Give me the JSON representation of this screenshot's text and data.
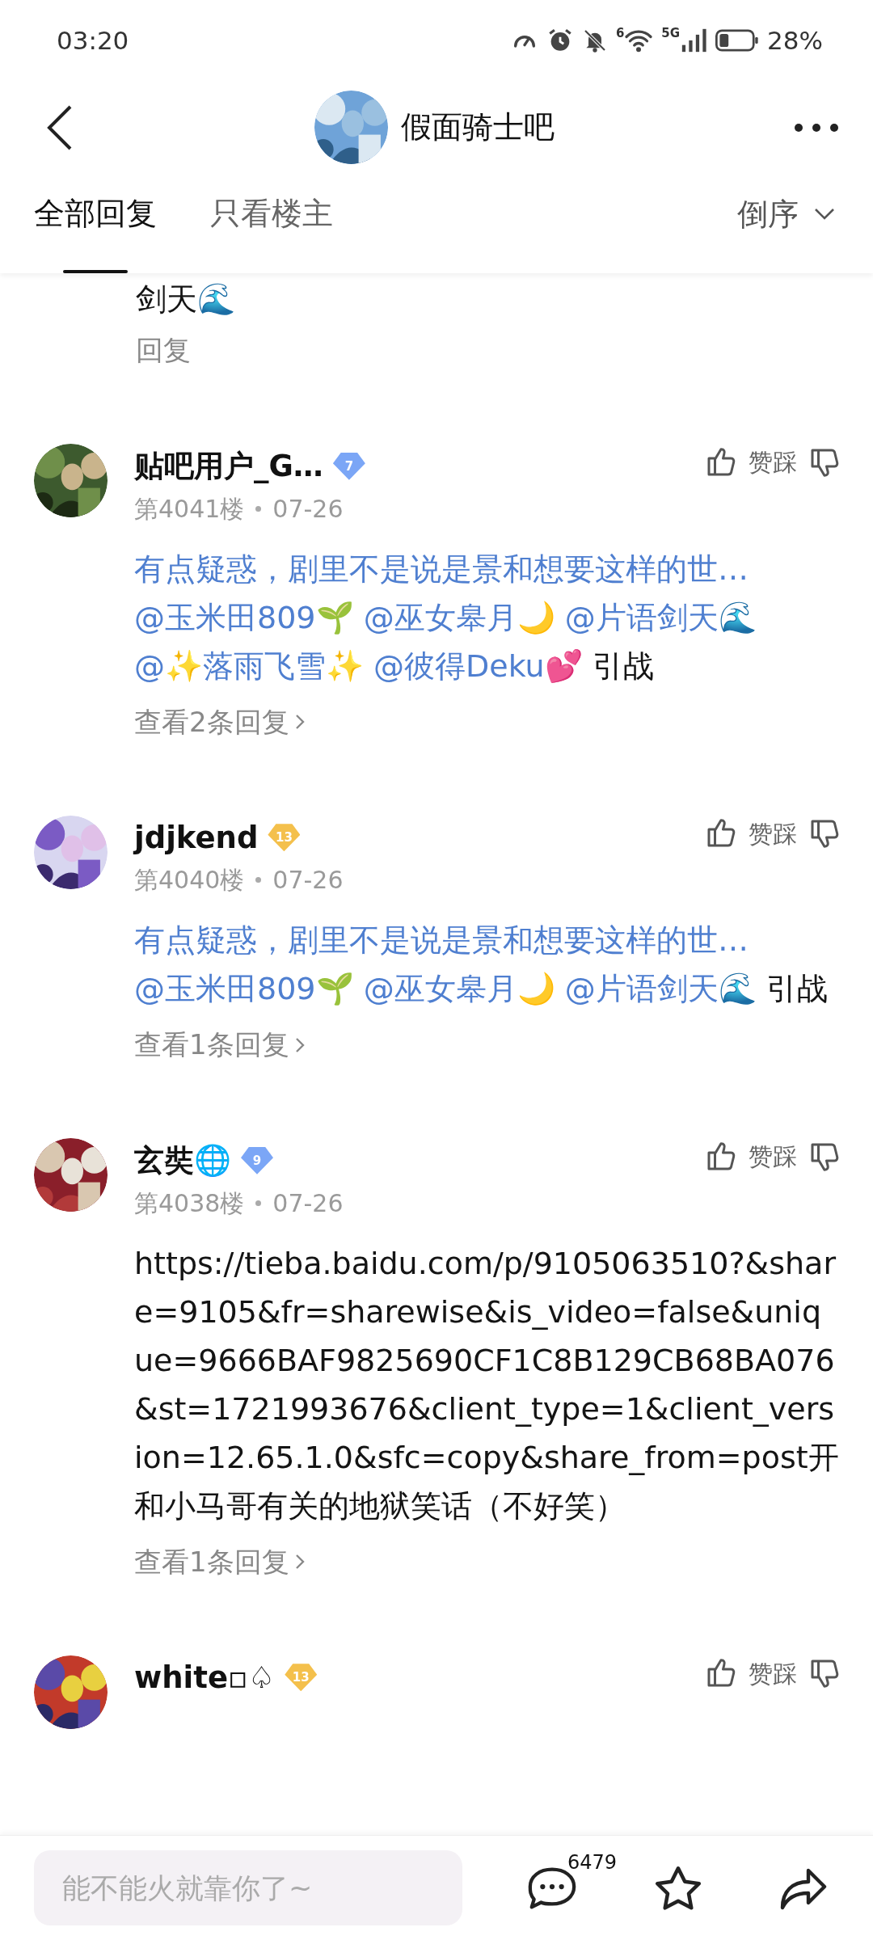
{
  "status_bar": {
    "time": "03:20",
    "wifi_label": "6",
    "network_label": "5G",
    "battery": "28%"
  },
  "header": {
    "title": "假面骑士吧"
  },
  "tabs": [
    {
      "label": "全部回复",
      "selected": true
    },
    {
      "label": "只看楼主",
      "selected": false
    }
  ],
  "sort": {
    "label": "倒序"
  },
  "partial_post": {
    "text": "剑天🌊",
    "action": "回复"
  },
  "posts": [
    {
      "name": "贴吧用户_G…",
      "rank_badge": "7",
      "color": "#7ba6f6",
      "floor": "第4041楼",
      "date": "07-26",
      "vote_label": "赞踩",
      "body": [
        {
          "kind": "quote",
          "text": "有点疑惑，剧里不是说是景和想要这样的世…"
        },
        {
          "kind": "mention",
          "text": "@玉米田809🌱"
        },
        {
          "kind": "mention",
          "text": "@巫女皋月🌙"
        },
        {
          "kind": "mention",
          "text": "@片语剑天🌊"
        },
        {
          "kind": "mention",
          "text": "@✨落雨飞雪✨"
        },
        {
          "kind": "mention",
          "text": "@彼得Deku💕"
        },
        {
          "kind": "plain",
          "text": "引战"
        }
      ],
      "replies_link": "查看2条回复"
    },
    {
      "name": "jdjkend",
      "rank_badge": "13",
      "color": "#f4c04c",
      "floor": "第4040楼",
      "date": "07-26",
      "vote_label": "赞踩",
      "body": [
        {
          "kind": "quote",
          "text": "有点疑惑，剧里不是说是景和想要这样的世…"
        },
        {
          "kind": "mention",
          "text": "@玉米田809🌱"
        },
        {
          "kind": "mention",
          "text": "@巫女皋月🌙"
        },
        {
          "kind": "mention",
          "text": "@片语剑天🌊"
        },
        {
          "kind": "plain",
          "text": "引战"
        }
      ],
      "replies_link": "查看1条回复"
    },
    {
      "name": "玄奘🌐",
      "rank_badge": "9",
      "color": "#7ba6f6",
      "floor": "第4038楼",
      "date": "07-26",
      "vote_label": "赞踩",
      "body": [
        {
          "kind": "plain",
          "text": "https://tieba.baidu.com/p/9105063510?&share=9105&fr=sharewise&is_video=false&unique=9666BAF9825690CF1C8B129CB68BA076&st=1721993676&client_type=1&client_version=12.65.1.0&sfc=copy&share_from=post开和小马哥有关的地狱笑话（不好笑）"
        }
      ],
      "replies_link": "查看1条回复"
    },
    {
      "name": "white▫♤",
      "rank_badge": "13",
      "color": "#f4c04c",
      "vote_label": "赞踩"
    }
  ],
  "bottom_bar": {
    "placeholder": "能不能火就靠你了~",
    "comment_count": "6479"
  }
}
